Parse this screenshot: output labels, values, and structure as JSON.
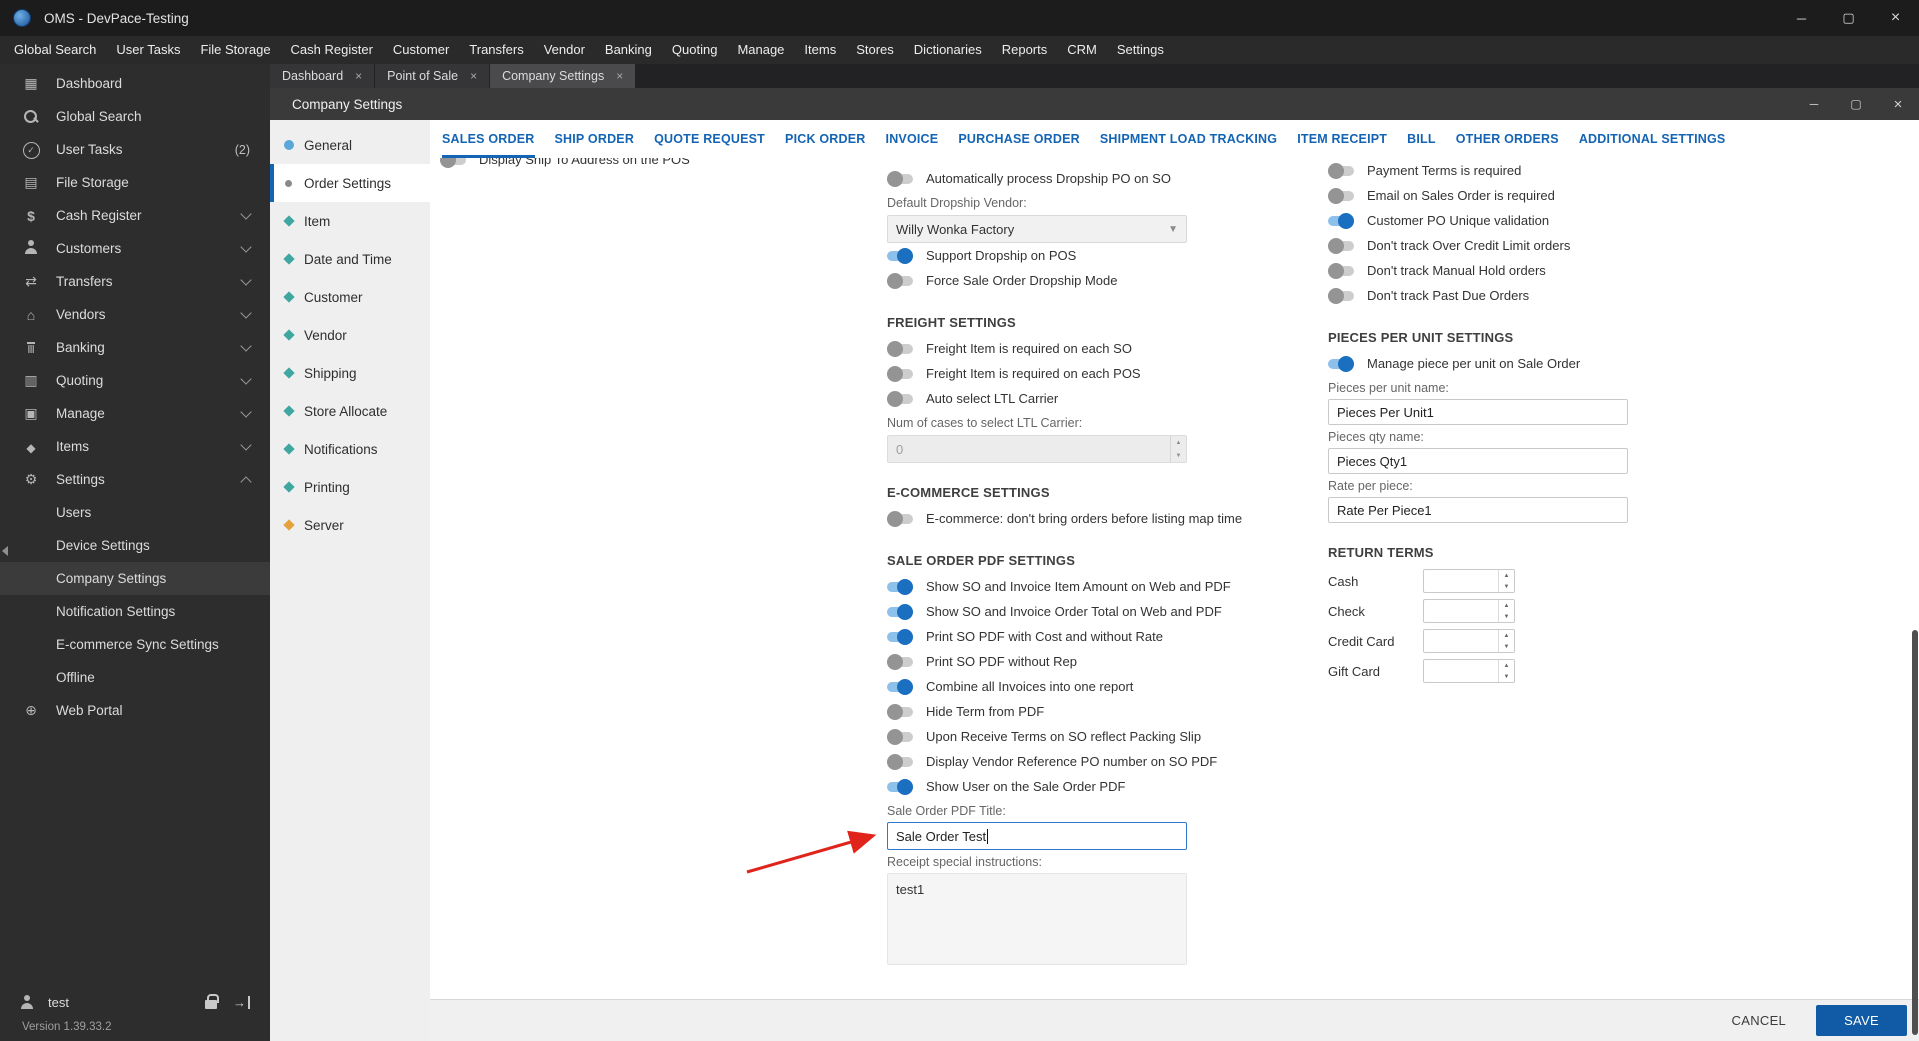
{
  "titlebar": {
    "title": "OMS - DevPace-Testing"
  },
  "menubar": {
    "items": [
      "Global Search",
      "User Tasks",
      "File Storage",
      "Cash Register",
      "Customer",
      "Transfers",
      "Vendor",
      "Banking",
      "Quoting",
      "Manage",
      "Items",
      "Stores",
      "Dictionaries",
      "Reports",
      "CRM",
      "Settings"
    ]
  },
  "sidebar": {
    "items": [
      {
        "label": "Dashboard",
        "icon": "dashboard"
      },
      {
        "label": "Global Search",
        "icon": "search"
      },
      {
        "label": "User Tasks",
        "icon": "tasks",
        "badge": "(2)"
      },
      {
        "label": "File Storage",
        "icon": "storage"
      },
      {
        "label": "Cash Register",
        "icon": "cash",
        "chevron": "down"
      },
      {
        "label": "Customers",
        "icon": "customers",
        "chevron": "down"
      },
      {
        "label": "Transfers",
        "icon": "transfers",
        "chevron": "down"
      },
      {
        "label": "Vendors",
        "icon": "vendors",
        "chevron": "down"
      },
      {
        "label": "Banking",
        "icon": "banking",
        "chevron": "down"
      },
      {
        "label": "Quoting",
        "icon": "quoting",
        "chevron": "down"
      },
      {
        "label": "Manage",
        "icon": "manage",
        "chevron": "down"
      },
      {
        "label": "Items",
        "icon": "items",
        "chevron": "down"
      },
      {
        "label": "Settings",
        "icon": "settings",
        "chevron": "up"
      },
      {
        "label": "Users",
        "sub": true
      },
      {
        "label": "Device Settings",
        "sub": true
      },
      {
        "label": "Company Settings",
        "sub": true,
        "active": true
      },
      {
        "label": "Notification Settings",
        "sub": true
      },
      {
        "label": "E-commerce Sync Settings",
        "sub": true
      },
      {
        "label": "Offline",
        "sub": true
      },
      {
        "label": "Web Portal",
        "icon": "web"
      }
    ],
    "user": "test",
    "version": "Version 1.39.33.2"
  },
  "doc_tabs": [
    {
      "label": "Dashboard"
    },
    {
      "label": "Point of Sale"
    },
    {
      "label": "Company Settings",
      "active": true
    }
  ],
  "inner_window": {
    "title": "Company Settings"
  },
  "settings_nav": [
    {
      "label": "General",
      "shape": "circle",
      "color": "#5aa7d8"
    },
    {
      "label": "Order Settings",
      "shape": "dot",
      "color": "#8a8a8a",
      "active": true
    },
    {
      "label": "Item",
      "shape": "diamond",
      "color": "#3fa7a0"
    },
    {
      "label": "Date and Time",
      "shape": "diamond",
      "color": "#3fa7a0"
    },
    {
      "label": "Customer",
      "shape": "diamond",
      "color": "#3fa7a0"
    },
    {
      "label": "Vendor",
      "shape": "diamond",
      "color": "#3fa7a0"
    },
    {
      "label": "Shipping",
      "shape": "diamond",
      "color": "#3fa7a0"
    },
    {
      "label": "Store Allocate",
      "shape": "diamond",
      "color": "#3fa7a0"
    },
    {
      "label": "Notifications",
      "shape": "diamond",
      "color": "#3fa7a0"
    },
    {
      "label": "Printing",
      "shape": "diamond",
      "color": "#3fa7a0"
    },
    {
      "label": "Server",
      "shape": "diamond",
      "color": "#e3a23c"
    }
  ],
  "tabs": [
    {
      "label": "SALES ORDER",
      "active": true
    },
    {
      "label": "SHIP ORDER"
    },
    {
      "label": "QUOTE REQUEST"
    },
    {
      "label": "PICK ORDER"
    },
    {
      "label": "INVOICE"
    },
    {
      "label": "PURCHASE ORDER"
    },
    {
      "label": "SHIPMENT LOAD TRACKING"
    },
    {
      "label": "ITEM RECEIPT"
    },
    {
      "label": "BILL"
    },
    {
      "label": "OTHER ORDERS"
    },
    {
      "label": "ADDITIONAL SETTINGS"
    }
  ],
  "columns": {
    "col1": [
      {
        "type": "toggle",
        "label": "Display Ship To Address on the POS",
        "on": false,
        "clipped": true
      }
    ],
    "col2": [
      {
        "type": "toggle",
        "label": "Automatically process Dropship PO on SO",
        "on": false
      },
      {
        "type": "label",
        "text": "Default Dropship Vendor:"
      },
      {
        "type": "select",
        "name": "default-dropship-vendor",
        "value": "Willy Wonka Factory"
      },
      {
        "type": "toggle",
        "label": "Support Dropship on POS",
        "on": true
      },
      {
        "type": "toggle",
        "label": "Force Sale Order Dropship Mode",
        "on": false
      },
      {
        "type": "header",
        "text": "FREIGHT SETTINGS"
      },
      {
        "type": "toggle",
        "label": "Freight Item is required on each SO",
        "on": false
      },
      {
        "type": "toggle",
        "label": "Freight Item is required on each POS",
        "on": false
      },
      {
        "type": "toggle",
        "label": "Auto select LTL Carrier",
        "on": false
      },
      {
        "type": "label",
        "text": "Num of cases to select LTL Carrier:"
      },
      {
        "type": "spinner",
        "name": "num-of-cases-ltl-carrier",
        "value": "0",
        "disabled": true
      },
      {
        "type": "header",
        "text": "E-COMMERCE SETTINGS"
      },
      {
        "type": "toggle",
        "label": "E-commerce: don't bring orders before listing map time",
        "on": false
      },
      {
        "type": "header",
        "text": "SALE ORDER PDF SETTINGS"
      },
      {
        "type": "toggle",
        "label": "Show SO and Invoice Item Amount on Web and PDF",
        "on": true
      },
      {
        "type": "toggle",
        "label": "Show SO and Invoice Order Total on Web and PDF",
        "on": true
      },
      {
        "type": "toggle",
        "label": "Print SO PDF with Cost and without Rate",
        "on": true
      },
      {
        "type": "toggle",
        "label": "Print SO PDF without Rep",
        "on": false
      },
      {
        "type": "toggle",
        "label": "Combine all Invoices into one report",
        "on": true
      },
      {
        "type": "toggle",
        "label": "Hide Term from PDF",
        "on": false
      },
      {
        "type": "toggle",
        "label": "Upon Receive Terms on SO reflect Packing Slip",
        "on": false
      },
      {
        "type": "toggle",
        "label": "Display Vendor Reference PO number on SO PDF",
        "on": false
      },
      {
        "type": "toggle",
        "label": "Show User on the Sale Order PDF",
        "on": true
      },
      {
        "type": "label",
        "text": "Sale Order PDF Title:"
      },
      {
        "type": "input",
        "name": "sale-order-pdf-title",
        "value": "Sale Order Test",
        "focused": true
      },
      {
        "type": "label",
        "text": "Receipt special instructions:"
      },
      {
        "type": "textarea",
        "name": "receipt-special-instructions",
        "value": "test1"
      }
    ],
    "col3": [
      {
        "type": "toggle",
        "label": "Payment Terms is required",
        "on": false
      },
      {
        "type": "toggle",
        "label": "Email on Sales Order is required",
        "on": false
      },
      {
        "type": "toggle",
        "label": "Customer PO Unique validation",
        "on": true
      },
      {
        "type": "toggle",
        "label": "Don't track Over Credit Limit orders",
        "on": false
      },
      {
        "type": "toggle",
        "label": "Don't track Manual Hold orders",
        "on": false
      },
      {
        "type": "toggle",
        "label": "Don't track Past Due Orders",
        "on": false
      },
      {
        "type": "header",
        "text": "PIECES PER UNIT SETTINGS"
      },
      {
        "type": "toggle",
        "label": "Manage piece per unit on Sale Order",
        "on": true
      },
      {
        "type": "label",
        "text": "Pieces per unit name:"
      },
      {
        "type": "input",
        "name": "pieces-per-unit-name",
        "value": "Pieces Per Unit1"
      },
      {
        "type": "label",
        "text": "Pieces qty name:"
      },
      {
        "type": "input",
        "name": "pieces-qty-name",
        "value": "Pieces Qty1"
      },
      {
        "type": "label",
        "text": "Rate per piece:"
      },
      {
        "type": "input",
        "name": "rate-per-piece",
        "value": "Rate Per Piece1"
      },
      {
        "type": "header",
        "text": "RETURN TERMS"
      },
      {
        "type": "inline-spinner",
        "label": "Cash",
        "value": ""
      },
      {
        "type": "inline-spinner",
        "label": "Check",
        "value": ""
      },
      {
        "type": "inline-spinner",
        "label": "Credit Card",
        "value": ""
      },
      {
        "type": "inline-spinner",
        "label": "Gift Card",
        "value": ""
      }
    ]
  },
  "footer": {
    "cancel": "CANCEL",
    "save": "SAVE"
  },
  "colors": {
    "accent": "#1464b4",
    "toggle_on": "#1a6fc0",
    "save_button": "#115aa5",
    "annotation_arrow": "#e0241b"
  }
}
